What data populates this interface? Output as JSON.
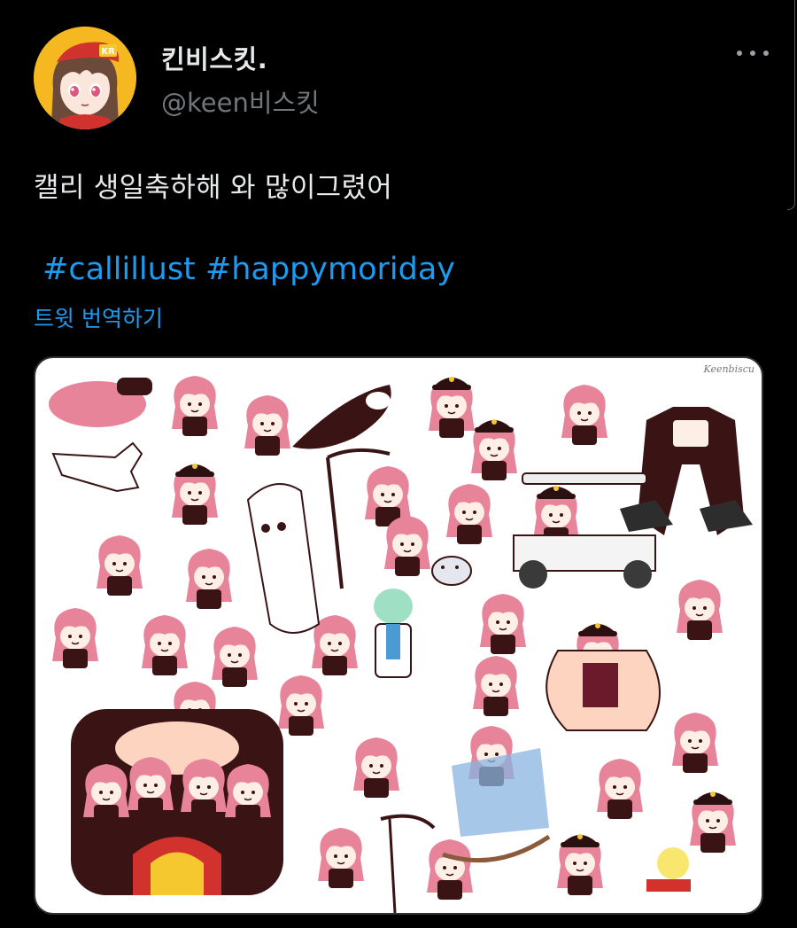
{
  "author": {
    "display_name": "킨비스킷.",
    "handle": "@keen비스킷"
  },
  "tweet": {
    "text": "캘리 생일축하해 와 많이그렸어",
    "hashtags": [
      "#callillust",
      "#happymoriday"
    ],
    "translate_label": "트윗 번역하기"
  },
  "media": {
    "watermark": "Keenbiscu"
  },
  "colors": {
    "background": "#000000",
    "link": "#1d9bf0",
    "avatar_bg": "#f6b820",
    "character_pink": "#e8849a",
    "character_dark": "#3a1414"
  }
}
